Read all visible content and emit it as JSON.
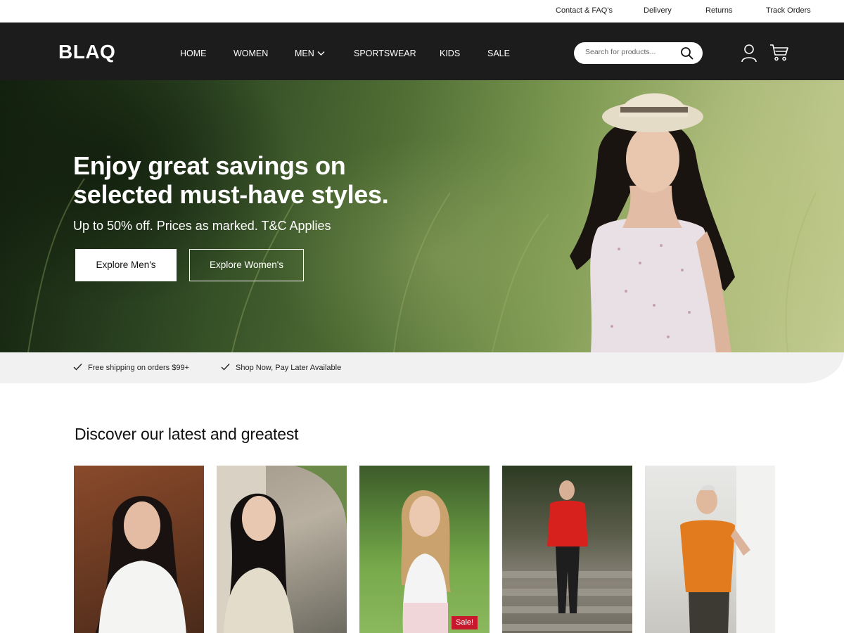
{
  "utility_bar": {
    "links": [
      "Contact & FAQ's",
      "Delivery",
      "Returns",
      "Track Orders"
    ]
  },
  "header": {
    "logo": "BLAQ",
    "nav": [
      "HOME",
      "WOMEN",
      "MEN",
      "SPORTSWEAR",
      "KIDS",
      "SALE"
    ],
    "search_placeholder": "Search for products...",
    "icons": [
      "search-icon",
      "user-icon",
      "cart-icon",
      "chevron-down-icon"
    ]
  },
  "hero": {
    "title": "Enjoy great savings on selected must-have styles.",
    "subtitle": "Up to 50% off. Prices as marked. T&C Applies",
    "primary_button": "Explore Men's",
    "secondary_button": "Explore Women's"
  },
  "promo": {
    "items": [
      "Free shipping on orders $99+",
      "Shop Now, Pay Later Available"
    ]
  },
  "section": {
    "title": "Discover our latest and greatest",
    "products": [
      {
        "image": "woman-white-blouse-photo"
      },
      {
        "image": "woman-beige-cardigan-photo"
      },
      {
        "image": "woman-white-tee-golf-photo",
        "badge": "Sale!"
      },
      {
        "image": "man-red-jacket-stairs-photo"
      },
      {
        "image": "man-orange-tee-running-photo"
      }
    ]
  },
  "colors": {
    "nav_background": "#1c1c1c",
    "promo_background": "#f1f1f1",
    "sale_badge": "#c8182e"
  }
}
